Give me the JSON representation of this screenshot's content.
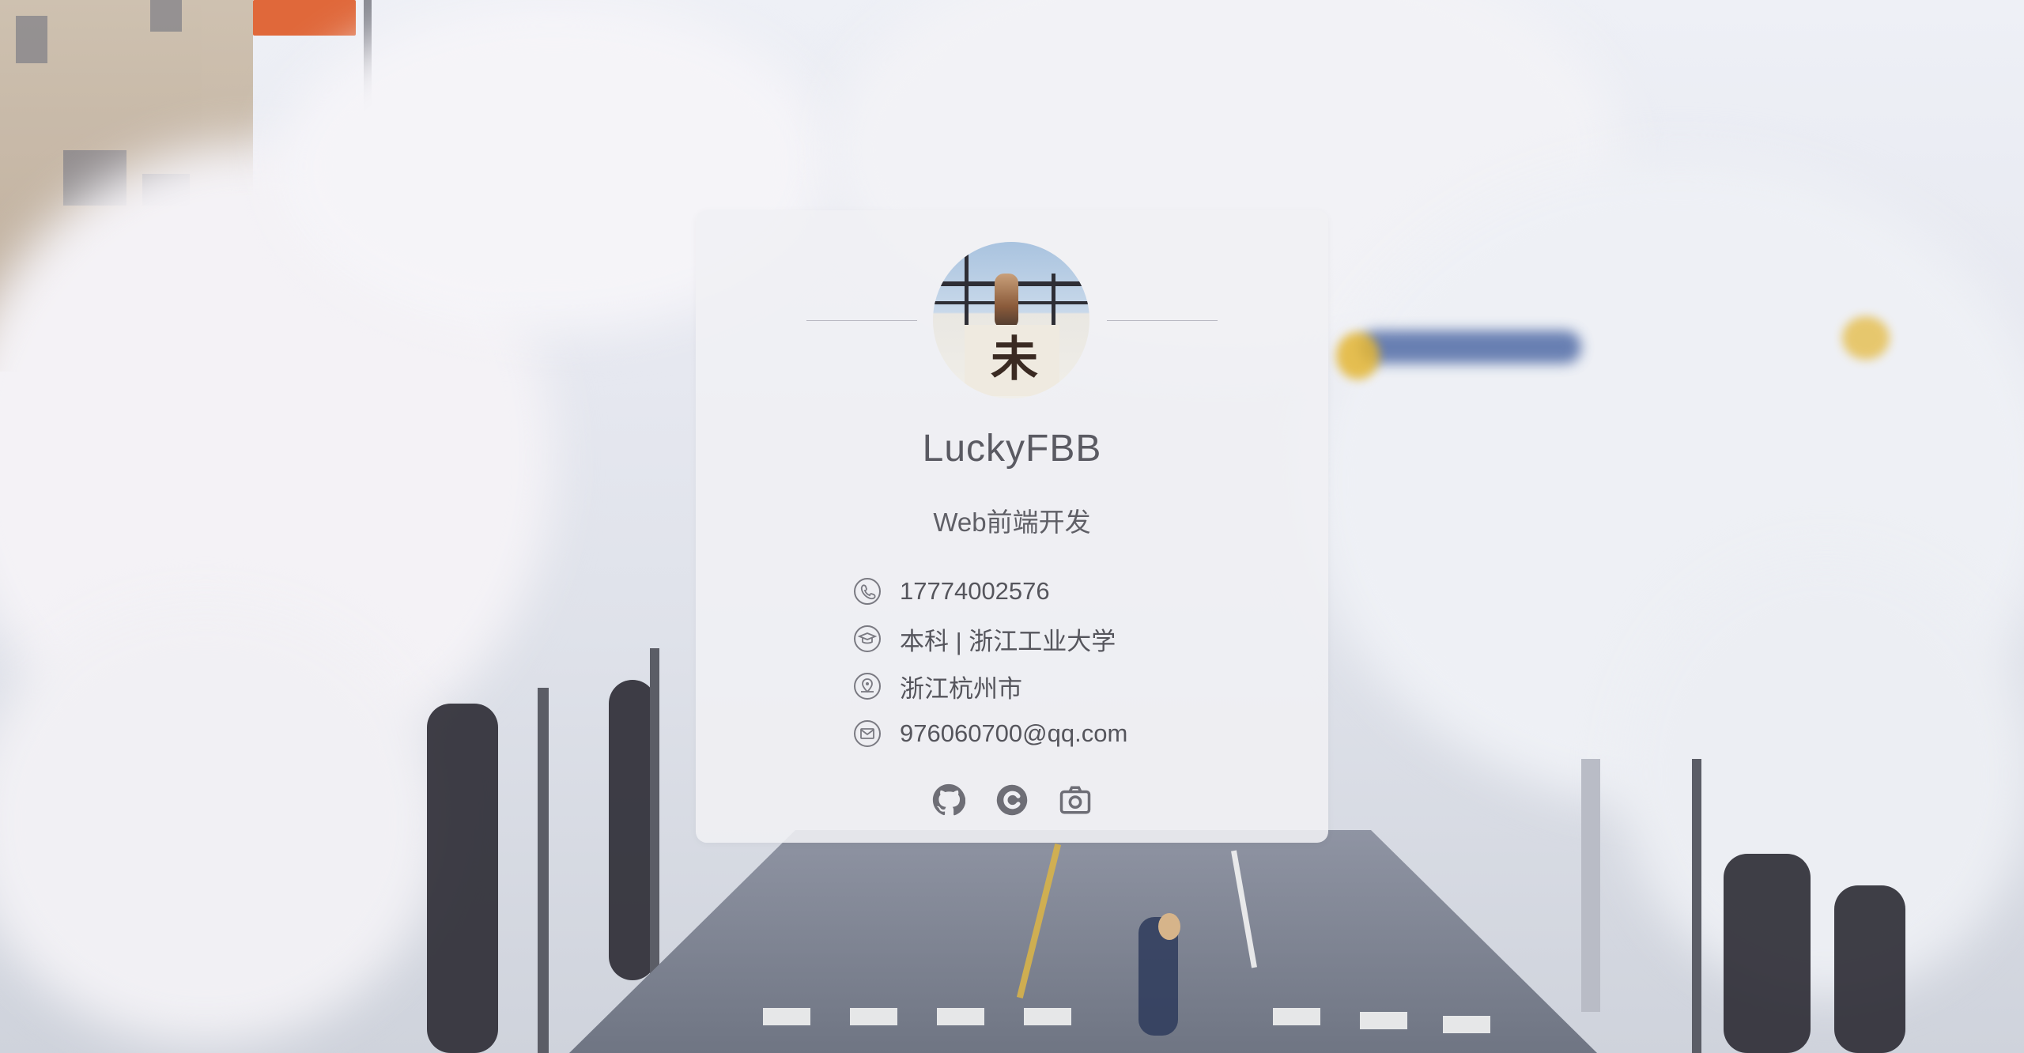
{
  "profile": {
    "name": "LuckyFBB",
    "title": "Web前端开发",
    "avatar_text": "未来",
    "info": [
      {
        "icon": "phone-icon",
        "text": "17774002576"
      },
      {
        "icon": "graduation-cap-icon",
        "text": "本科 | 浙江工业大学"
      },
      {
        "icon": "location-icon",
        "text": "浙江杭州市"
      },
      {
        "icon": "mail-icon",
        "text": "976060700@qq.com"
      }
    ],
    "socials": [
      {
        "icon": "github-icon"
      },
      {
        "icon": "blog-icon"
      },
      {
        "icon": "camera-icon"
      }
    ]
  },
  "colors": {
    "text": "#5a5a62",
    "card_bg": "rgba(240,240,244,0.88)"
  }
}
